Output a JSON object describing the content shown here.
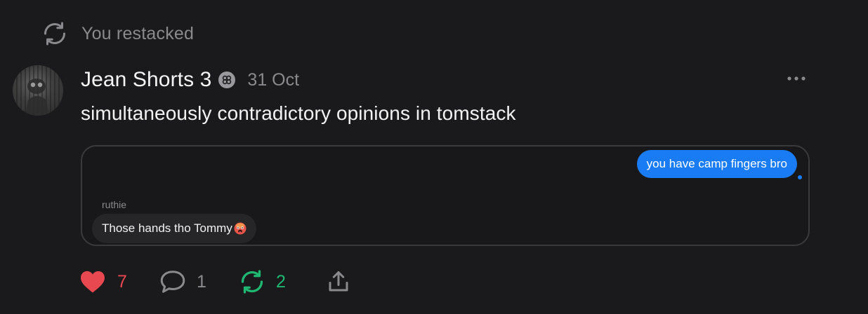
{
  "restack_banner": {
    "icon": "restack-icon",
    "text": "You restacked"
  },
  "post": {
    "author": "Jean Shorts 3",
    "date": "31 Oct",
    "badge_icon": "subscriber-badge-icon",
    "body": "simultaneously contradictory opinions in tomstack",
    "more_icon": "more-options-icon"
  },
  "media": {
    "sent_message": "you have camp fingers bro",
    "sender_name": "ruthie",
    "received_message": "Those hands tho Tommy",
    "received_emoji": "hot-face-emoji"
  },
  "actions": {
    "likes": "7",
    "comments": "1",
    "restacks": "2",
    "share_icon": "share-icon"
  },
  "colors": {
    "background": "#1a1a1c",
    "like": "#e8484f",
    "restack": "#1fb872",
    "sent_bubble": "#1a7cf5",
    "muted_text": "#8a8a8e"
  }
}
